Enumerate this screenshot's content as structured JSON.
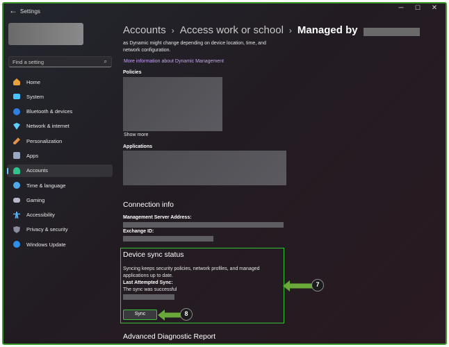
{
  "window": {
    "title": "Settings",
    "back_icon": "back-arrow-icon",
    "controls": {
      "minimize": "─",
      "maximize": "☐",
      "close": "✕"
    }
  },
  "sidebar": {
    "search_placeholder": "Find a setting",
    "items": [
      {
        "label": "Home",
        "icon": "home-icon",
        "color": "#e8a33d"
      },
      {
        "label": "System",
        "icon": "system-icon",
        "color": "#4cc2ff"
      },
      {
        "label": "Bluetooth & devices",
        "icon": "bluetooth-icon",
        "color": "#2f7fe0"
      },
      {
        "label": "Network & internet",
        "icon": "wifi-icon",
        "color": "#60cdff"
      },
      {
        "label": "Personalization",
        "icon": "brush-icon",
        "color": "#e0904a"
      },
      {
        "label": "Apps",
        "icon": "apps-icon",
        "color": "#9aa6c2"
      },
      {
        "label": "Accounts",
        "icon": "accounts-icon",
        "color": "#2fc28a",
        "active": true
      },
      {
        "label": "Time & language",
        "icon": "globe-icon",
        "color": "#4fa8e8"
      },
      {
        "label": "Gaming",
        "icon": "gaming-icon",
        "color": "#b8b8c8"
      },
      {
        "label": "Accessibility",
        "icon": "accessibility-icon",
        "color": "#5ab0f0"
      },
      {
        "label": "Privacy & security",
        "icon": "shield-icon",
        "color": "#8c8c9c"
      },
      {
        "label": "Windows Update",
        "icon": "update-icon",
        "color": "#2f8fe8"
      }
    ]
  },
  "breadcrumb": {
    "part1": "Accounts",
    "part2": "Access work or school",
    "current": "Managed by",
    "separator": "›"
  },
  "main": {
    "intro_line1": "as Dynamic might change depending on device location, time, and",
    "intro_line2": "network configuration.",
    "more_info_link": "More information about Dynamic Management",
    "policies_label": "Policies",
    "show_more": "Show more",
    "applications_label": "Applications",
    "connection_info_title": "Connection info",
    "mgmt_server_label": "Management Server Address:",
    "exchange_id_label": "Exchange ID:",
    "sync_title": "Device sync status",
    "sync_desc_line1": "Syncing keeps security policies, network profiles, and managed",
    "sync_desc_line2": "applications up to date.",
    "last_sync_label": "Last Attempted Sync:",
    "sync_result": "The sync was successful",
    "sync_button": "Sync",
    "adv_report_title": "Advanced Diagnostic Report"
  },
  "callouts": {
    "panel_number": "7",
    "button_number": "8",
    "color": "#6aa83a"
  }
}
